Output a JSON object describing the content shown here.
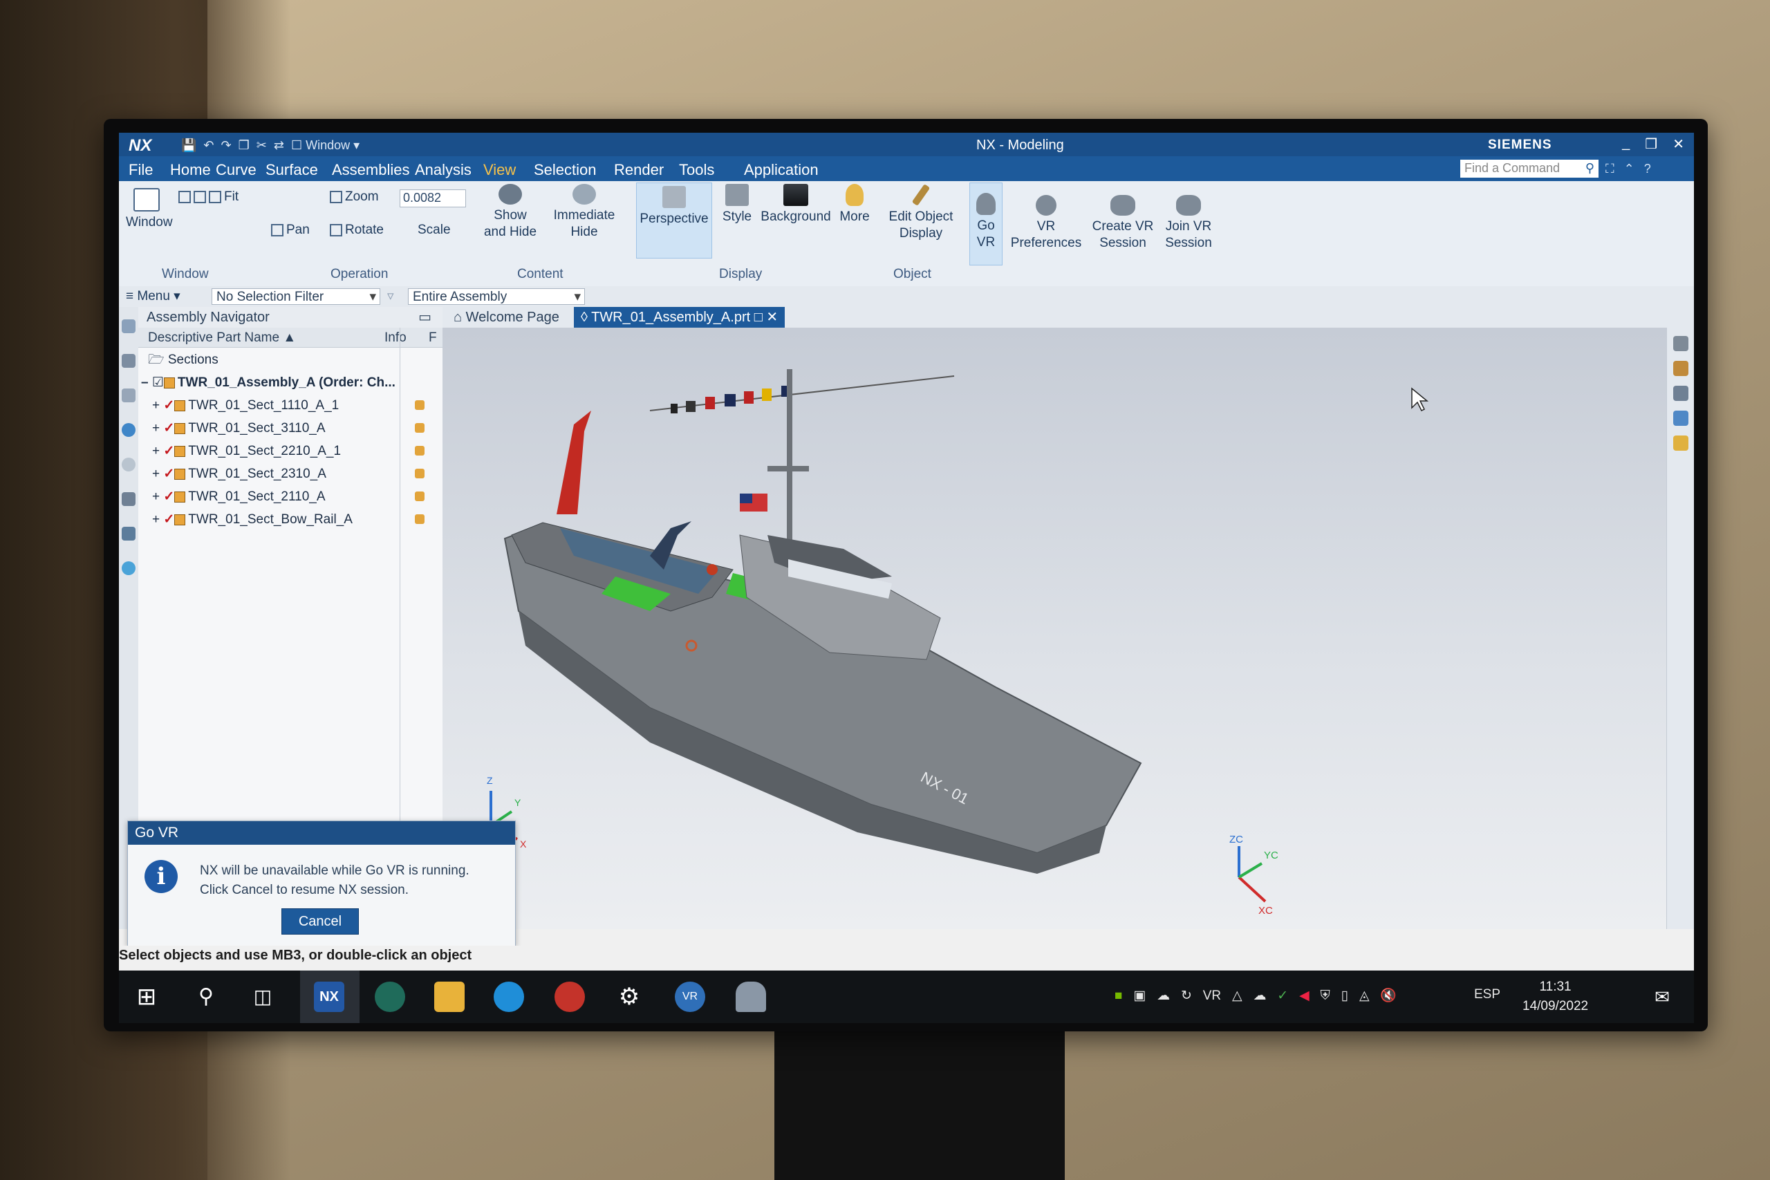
{
  "titlebar": {
    "app_logo": "NX",
    "window_menu": "Window",
    "title": "NX - Modeling",
    "brand": "SIEMENS",
    "minimize": "_",
    "restore": "❒",
    "close": "✕"
  },
  "menubar": {
    "items": [
      "File",
      "Home",
      "Curve",
      "Surface",
      "Assemblies",
      "Analysis",
      "View",
      "Selection",
      "Render",
      "Tools",
      "Application"
    ],
    "active": "View",
    "find_placeholder": "Find a Command"
  },
  "ribbon": {
    "window_label": "Window",
    "fit": "Fit",
    "zoom": "Zoom",
    "scale_value": "0.0082",
    "scale_label": "Scale",
    "pan": "Pan",
    "rotate": "Rotate",
    "show_hide_1": "Show",
    "show_hide_2": "and Hide",
    "immediate_hide_1": "Immediate",
    "immediate_hide_2": "Hide",
    "perspective": "Perspective",
    "style": "Style",
    "background": "Background",
    "more": "More",
    "edit_obj_1": "Edit Object",
    "edit_obj_2": "Display",
    "go_vr_1": "Go",
    "go_vr_2": "VR",
    "vr_pref_1": "VR",
    "vr_pref_2": "Preferences",
    "create_vr_1": "Create VR",
    "create_vr_2": "Session",
    "join_vr_1": "Join VR",
    "join_vr_2": "Session",
    "groups": {
      "window": "Window",
      "operation": "Operation",
      "content": "Content",
      "display": "Display",
      "object": "Object"
    }
  },
  "filterbar": {
    "menu": "Menu",
    "selection_filter": "No Selection Filter",
    "scope": "Entire Assembly"
  },
  "navigator": {
    "title": "Assembly Navigator",
    "col_name": "Descriptive Part Name",
    "col_info": "Info",
    "col_f": "F",
    "sections": "Sections",
    "root": "TWR_01_Assembly_A (Order: Ch...",
    "children": [
      "TWR_01_Sect_1110_A_1",
      "TWR_01_Sect_3110_A",
      "TWR_01_Sect_2210_A_1",
      "TWR_01_Sect_2310_A",
      "TWR_01_Sect_2110_A",
      "TWR_01_Sect_Bow_Rail_A"
    ]
  },
  "tabs": {
    "welcome": "Welcome Page",
    "assembly": "TWR_01_Assembly_A.prt"
  },
  "viewport": {
    "hull_text": "NX - 01",
    "triad": {
      "z": "Z",
      "y": "Y",
      "x": "X"
    },
    "wcs": {
      "zc": "ZC",
      "yc": "YC",
      "xc": "XC"
    }
  },
  "dialog": {
    "title": "Go VR",
    "line1": "NX will be unavailable while Go VR is running.",
    "line2": "Click Cancel to resume NX session.",
    "cancel": "Cancel"
  },
  "status": "Select objects and use MB3, or double-click an object",
  "taskbar": {
    "lang": "ESP",
    "time": "11:31",
    "date": "14/09/2022",
    "nx_label": "NX",
    "vr_label": "VR"
  },
  "colors": {
    "title_blue": "#1a4f8a",
    "menu_blue": "#1d5a9b",
    "active_tab_orange": "#f6c24b",
    "hull_grey": "#8e9296",
    "crane_red": "#c22a22",
    "deck_green": "#3fbf3a"
  }
}
